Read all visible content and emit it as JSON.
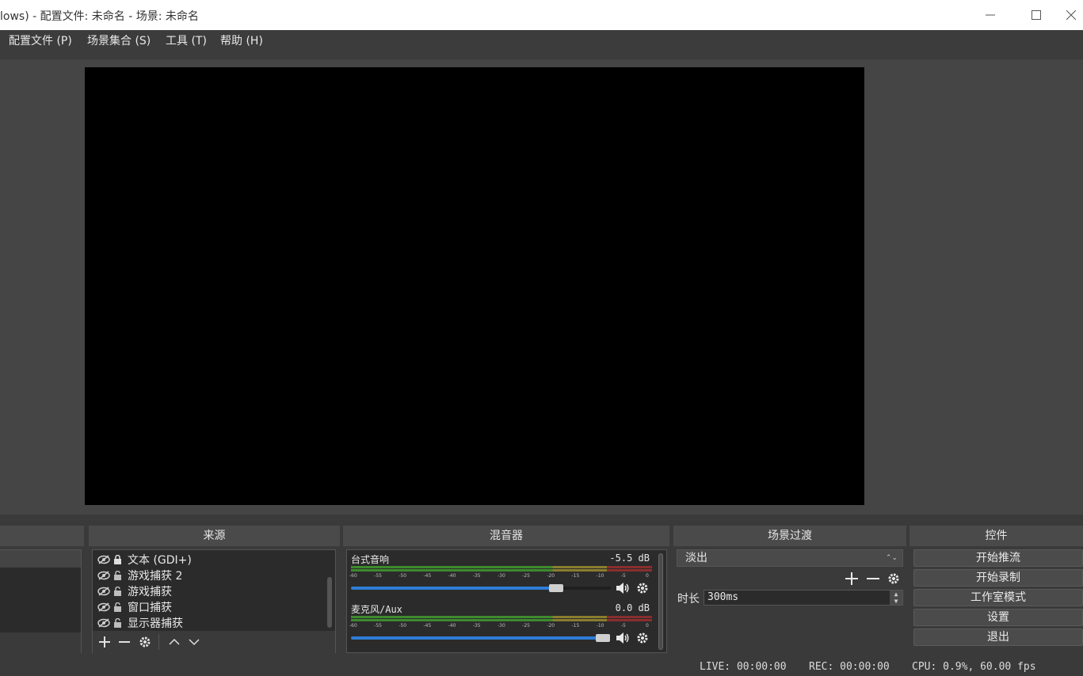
{
  "window": {
    "title": "lows) - 配置文件: 未命名 - 场景: 未命名",
    "minimize_icon": "minimize-icon",
    "maximize_icon": "maximize-icon",
    "close_icon": "close-icon"
  },
  "menu": {
    "profile": "配置文件 (P)",
    "scene_collection": "场景集合 (S)",
    "tools": "工具 (T)",
    "help": "帮助 (H)"
  },
  "docks": {
    "sources_title": "来源",
    "mixer_title": "混音器",
    "transitions_title": "场景过渡",
    "controls_title": "控件"
  },
  "sources": {
    "items": [
      {
        "label": "文本 (GDI+)",
        "locked": true
      },
      {
        "label": "游戏捕获 2",
        "locked": false
      },
      {
        "label": "游戏捕获",
        "locked": false
      },
      {
        "label": "窗口捕获",
        "locked": false
      },
      {
        "label": "显示器捕获",
        "locked": false
      }
    ]
  },
  "mixer": {
    "channels": [
      {
        "name": "台式音响",
        "db": "-5.5 dB",
        "volume_fraction": 0.79
      },
      {
        "name": "麦克风/Aux",
        "db": "0.0 dB",
        "volume_fraction": 0.97
      }
    ],
    "ticks": [
      "-60",
      "-55",
      "-50",
      "-45",
      "-40",
      "-35",
      "-30",
      "-25",
      "-20",
      "-15",
      "-10",
      "-5",
      "0"
    ]
  },
  "transitions": {
    "selected": "淡出",
    "duration_label": "时长",
    "duration_value": "300ms"
  },
  "controls": {
    "start_streaming": "开始推流",
    "start_recording": "开始录制",
    "studio_mode": "工作室模式",
    "settings": "设置",
    "exit": "退出"
  },
  "status": {
    "live": "LIVE: 00:00:00",
    "rec": "REC: 00:00:00",
    "cpu": "CPU: 0.9%, 60.00 fps"
  },
  "colors": {
    "accent": "#2e7dd6",
    "meter_green": "#3e8a2e",
    "meter_yellow": "#8a7d2e",
    "meter_red": "#8a2e2e"
  }
}
